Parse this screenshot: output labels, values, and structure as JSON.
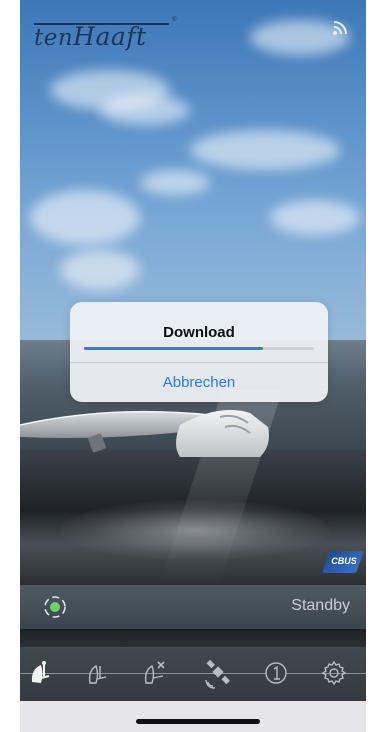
{
  "brand": {
    "logo_text_small": "ten",
    "logo_text_large": "Haaft"
  },
  "dialog": {
    "title": "Download",
    "cancel_label": "Abbrechen",
    "progress": 0.78
  },
  "badge": {
    "label": "CBUS"
  },
  "status": {
    "text": "Standby"
  },
  "toolbar": {
    "items": [
      {
        "icon": "antenna-up-icon",
        "active": true
      },
      {
        "icon": "antenna-down-icon",
        "active": false
      },
      {
        "icon": "antenna-cancel-icon",
        "active": false
      },
      {
        "icon": "satellite-icon",
        "active": false
      },
      {
        "icon": "info-one-icon",
        "active": false
      },
      {
        "icon": "gear-icon",
        "active": false
      }
    ]
  },
  "colors": {
    "accent": "#2a7ae2",
    "status_indicator": "#6fd36a"
  }
}
